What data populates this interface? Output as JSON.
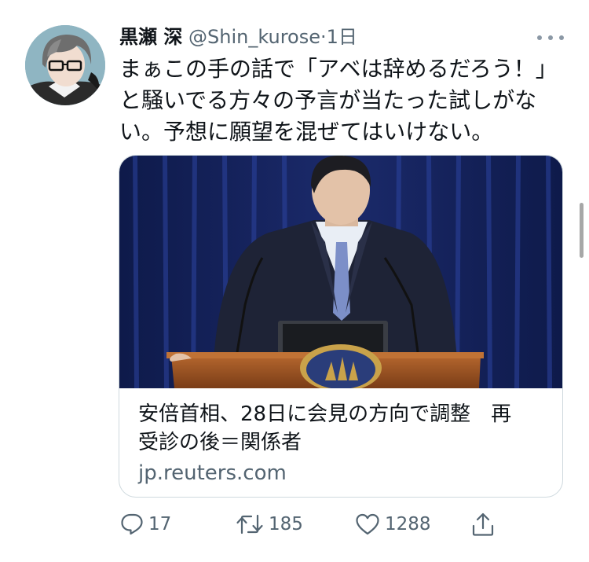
{
  "tweet": {
    "author_name": "黒瀬 深",
    "handle": "@Shin_kurose",
    "separator": "·",
    "time": "1日",
    "text_lines": [
      "まぁこの手の話で「アベは辞めるだろう！」",
      "と騒いでる方々の予言が当たった試しがな",
      "い。予想に願望を混ぜてはいけない。"
    ],
    "card": {
      "title_lines": [
        "安倍首相、28日に会見の方向で調整　再",
        "受診の後＝関係者"
      ],
      "domain": "jp.reuters.com"
    },
    "actions": {
      "replies": "17",
      "retweets": "185",
      "likes": "1288"
    }
  },
  "icons": {
    "more": "more-dots-icon",
    "reply": "reply-icon",
    "retweet": "retweet-icon",
    "like": "heart-icon",
    "share": "share-icon"
  },
  "colors": {
    "text": "#0f1419",
    "secondary": "#536471",
    "card_border": "#cfd9de"
  }
}
